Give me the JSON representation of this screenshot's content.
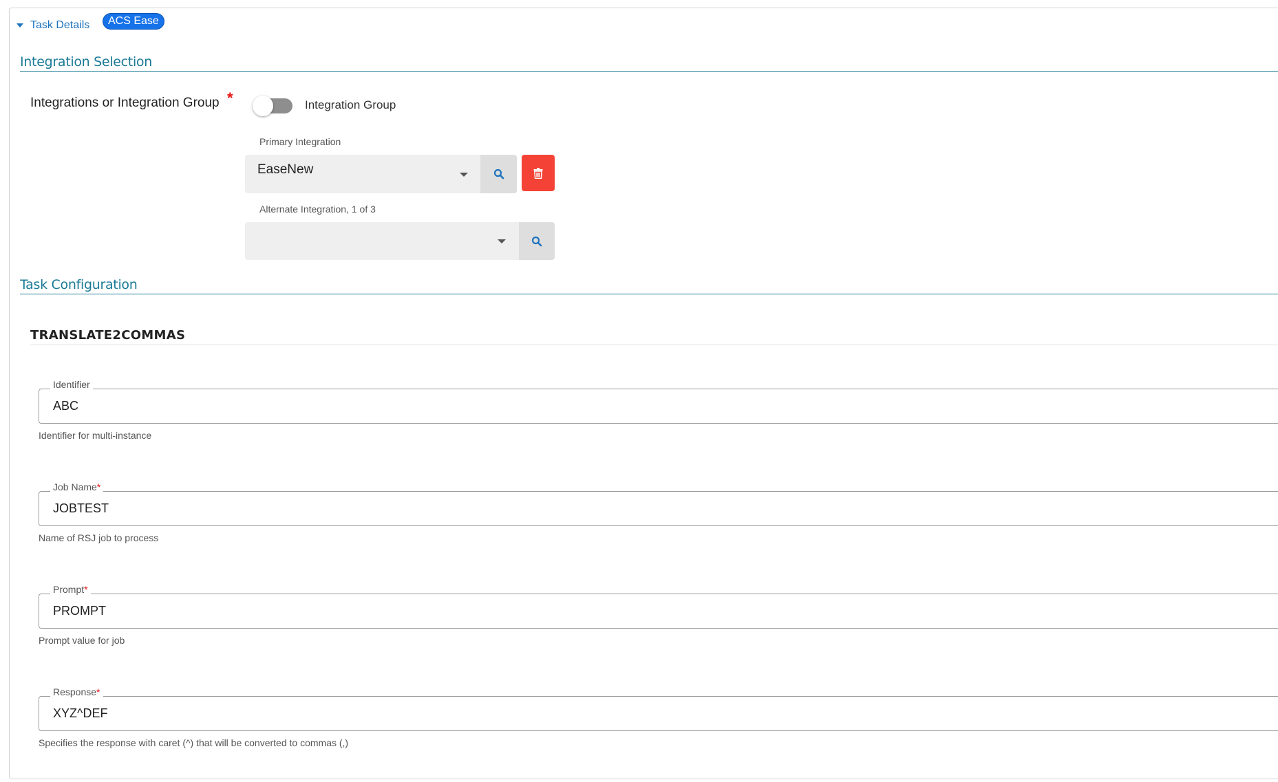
{
  "header": {
    "task_details_label": "Task Details",
    "badge": "ACS Ease"
  },
  "integration_section": {
    "title": "Integration Selection",
    "field_label": "Integrations or Integration Group",
    "required_mark": "*",
    "toggle_label": "Integration Group",
    "toggle_on": false,
    "primary": {
      "label": "Primary Integration",
      "value": "EaseNew"
    },
    "alternate": {
      "label": "Alternate Integration, 1 of 3",
      "value": ""
    }
  },
  "config_section": {
    "title": "Task Configuration",
    "subtitle": "TRANSLATE2COMMAS",
    "fields": [
      {
        "label": "Identifier",
        "required": false,
        "value": "ABC",
        "help": "Identifier for multi-instance"
      },
      {
        "label": "Job Name",
        "required": true,
        "value": "JOBTEST",
        "help": "Name of RSJ job to process"
      },
      {
        "label": "Prompt",
        "required": true,
        "value": "PROMPT",
        "help": "Prompt value for job"
      },
      {
        "label": "Response",
        "required": true,
        "value": "XYZ^DEF",
        "help": "Specifies the response with caret (^) that will be converted to commas (,)"
      }
    ]
  },
  "icons": {
    "expand": "caret-down-icon",
    "search": "search-icon",
    "delete": "trash-icon",
    "dropdown": "chevron-down-icon"
  },
  "colors": {
    "accent": "#1e73be",
    "section": "#1b7a96",
    "badge": "#1672e8",
    "danger": "#f44336",
    "required": "#e51414"
  }
}
